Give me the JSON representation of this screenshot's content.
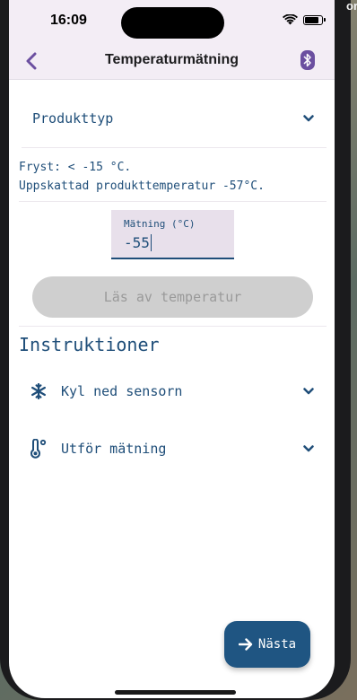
{
  "status_bar": {
    "time": "16:09",
    "battery_level": 0.85
  },
  "background_text": "or",
  "header": {
    "title": "Temperaturmätning",
    "back_icon": "chevron-left-icon",
    "bluetooth_icon": "bluetooth-icon"
  },
  "product": {
    "label": "Produkttyp",
    "icon": "chevron-down-icon"
  },
  "info": {
    "line1": "Fryst: < -15 °C.",
    "line2": "Uppskattad produkttemperatur -57°C."
  },
  "measurement": {
    "label": "Mätning (°C)",
    "value": "-55"
  },
  "read_button": {
    "label": "Läs av temperatur",
    "enabled": false
  },
  "instructions": {
    "heading": "Instruktioner",
    "items": [
      {
        "label": "Kyl ned sensorn",
        "icon": "snowflake-icon"
      },
      {
        "label": "Utför mätning",
        "icon": "thermometer-icon"
      }
    ]
  },
  "next_button": {
    "label": "Nästa",
    "icon": "arrow-right-icon"
  },
  "colors": {
    "primary": "#1f4e79",
    "header_bg": "#f3edf5",
    "field_bg": "#e8e0eb",
    "accent_purple": "#6b4fa0"
  }
}
